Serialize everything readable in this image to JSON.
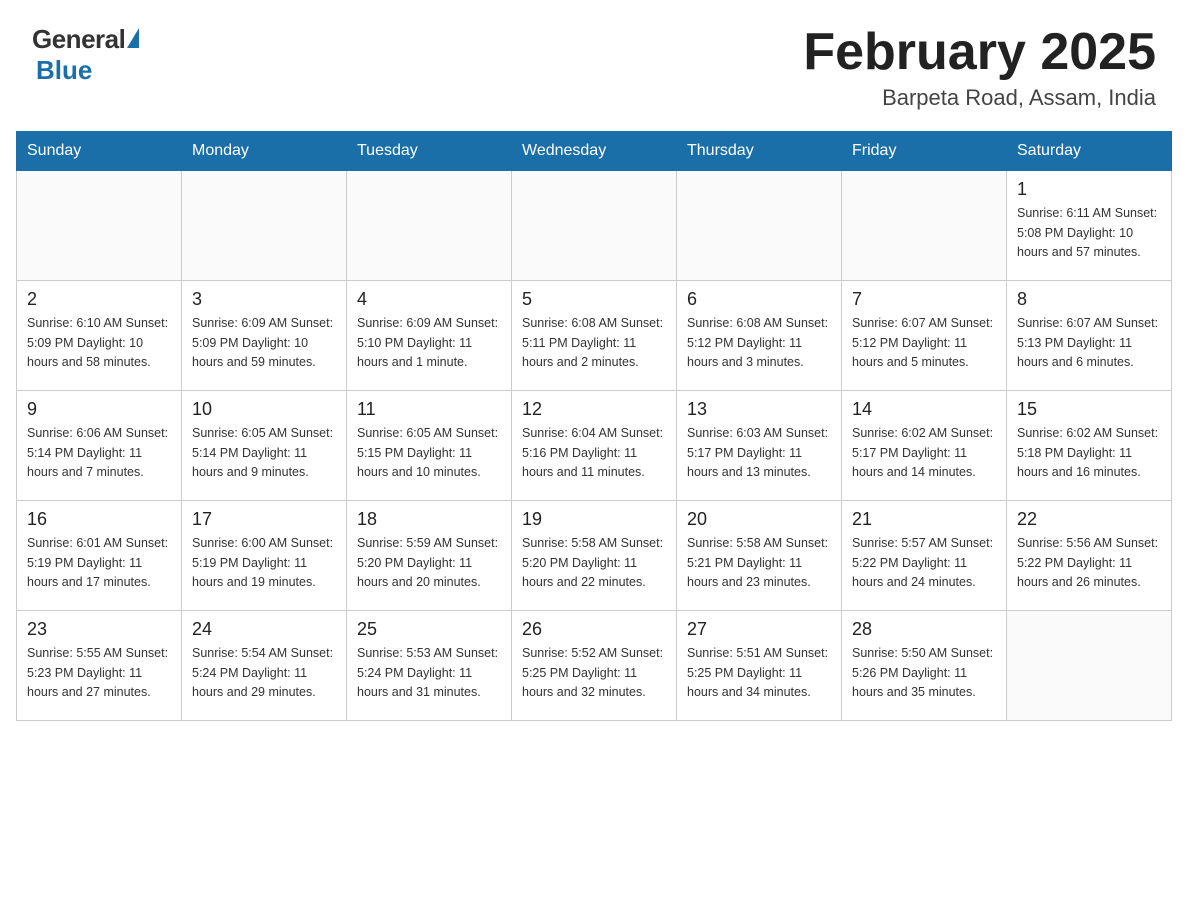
{
  "header": {
    "logo": {
      "general": "General",
      "blue": "Blue"
    },
    "title": "February 2025",
    "location": "Barpeta Road, Assam, India"
  },
  "days_of_week": [
    "Sunday",
    "Monday",
    "Tuesday",
    "Wednesday",
    "Thursday",
    "Friday",
    "Saturday"
  ],
  "weeks": [
    [
      {
        "day": "",
        "info": ""
      },
      {
        "day": "",
        "info": ""
      },
      {
        "day": "",
        "info": ""
      },
      {
        "day": "",
        "info": ""
      },
      {
        "day": "",
        "info": ""
      },
      {
        "day": "",
        "info": ""
      },
      {
        "day": "1",
        "info": "Sunrise: 6:11 AM\nSunset: 5:08 PM\nDaylight: 10 hours\nand 57 minutes."
      }
    ],
    [
      {
        "day": "2",
        "info": "Sunrise: 6:10 AM\nSunset: 5:09 PM\nDaylight: 10 hours\nand 58 minutes."
      },
      {
        "day": "3",
        "info": "Sunrise: 6:09 AM\nSunset: 5:09 PM\nDaylight: 10 hours\nand 59 minutes."
      },
      {
        "day": "4",
        "info": "Sunrise: 6:09 AM\nSunset: 5:10 PM\nDaylight: 11 hours\nand 1 minute."
      },
      {
        "day": "5",
        "info": "Sunrise: 6:08 AM\nSunset: 5:11 PM\nDaylight: 11 hours\nand 2 minutes."
      },
      {
        "day": "6",
        "info": "Sunrise: 6:08 AM\nSunset: 5:12 PM\nDaylight: 11 hours\nand 3 minutes."
      },
      {
        "day": "7",
        "info": "Sunrise: 6:07 AM\nSunset: 5:12 PM\nDaylight: 11 hours\nand 5 minutes."
      },
      {
        "day": "8",
        "info": "Sunrise: 6:07 AM\nSunset: 5:13 PM\nDaylight: 11 hours\nand 6 minutes."
      }
    ],
    [
      {
        "day": "9",
        "info": "Sunrise: 6:06 AM\nSunset: 5:14 PM\nDaylight: 11 hours\nand 7 minutes."
      },
      {
        "day": "10",
        "info": "Sunrise: 6:05 AM\nSunset: 5:14 PM\nDaylight: 11 hours\nand 9 minutes."
      },
      {
        "day": "11",
        "info": "Sunrise: 6:05 AM\nSunset: 5:15 PM\nDaylight: 11 hours\nand 10 minutes."
      },
      {
        "day": "12",
        "info": "Sunrise: 6:04 AM\nSunset: 5:16 PM\nDaylight: 11 hours\nand 11 minutes."
      },
      {
        "day": "13",
        "info": "Sunrise: 6:03 AM\nSunset: 5:17 PM\nDaylight: 11 hours\nand 13 minutes."
      },
      {
        "day": "14",
        "info": "Sunrise: 6:02 AM\nSunset: 5:17 PM\nDaylight: 11 hours\nand 14 minutes."
      },
      {
        "day": "15",
        "info": "Sunrise: 6:02 AM\nSunset: 5:18 PM\nDaylight: 11 hours\nand 16 minutes."
      }
    ],
    [
      {
        "day": "16",
        "info": "Sunrise: 6:01 AM\nSunset: 5:19 PM\nDaylight: 11 hours\nand 17 minutes."
      },
      {
        "day": "17",
        "info": "Sunrise: 6:00 AM\nSunset: 5:19 PM\nDaylight: 11 hours\nand 19 minutes."
      },
      {
        "day": "18",
        "info": "Sunrise: 5:59 AM\nSunset: 5:20 PM\nDaylight: 11 hours\nand 20 minutes."
      },
      {
        "day": "19",
        "info": "Sunrise: 5:58 AM\nSunset: 5:20 PM\nDaylight: 11 hours\nand 22 minutes."
      },
      {
        "day": "20",
        "info": "Sunrise: 5:58 AM\nSunset: 5:21 PM\nDaylight: 11 hours\nand 23 minutes."
      },
      {
        "day": "21",
        "info": "Sunrise: 5:57 AM\nSunset: 5:22 PM\nDaylight: 11 hours\nand 24 minutes."
      },
      {
        "day": "22",
        "info": "Sunrise: 5:56 AM\nSunset: 5:22 PM\nDaylight: 11 hours\nand 26 minutes."
      }
    ],
    [
      {
        "day": "23",
        "info": "Sunrise: 5:55 AM\nSunset: 5:23 PM\nDaylight: 11 hours\nand 27 minutes."
      },
      {
        "day": "24",
        "info": "Sunrise: 5:54 AM\nSunset: 5:24 PM\nDaylight: 11 hours\nand 29 minutes."
      },
      {
        "day": "25",
        "info": "Sunrise: 5:53 AM\nSunset: 5:24 PM\nDaylight: 11 hours\nand 31 minutes."
      },
      {
        "day": "26",
        "info": "Sunrise: 5:52 AM\nSunset: 5:25 PM\nDaylight: 11 hours\nand 32 minutes."
      },
      {
        "day": "27",
        "info": "Sunrise: 5:51 AM\nSunset: 5:25 PM\nDaylight: 11 hours\nand 34 minutes."
      },
      {
        "day": "28",
        "info": "Sunrise: 5:50 AM\nSunset: 5:26 PM\nDaylight: 11 hours\nand 35 minutes."
      },
      {
        "day": "",
        "info": ""
      }
    ]
  ]
}
